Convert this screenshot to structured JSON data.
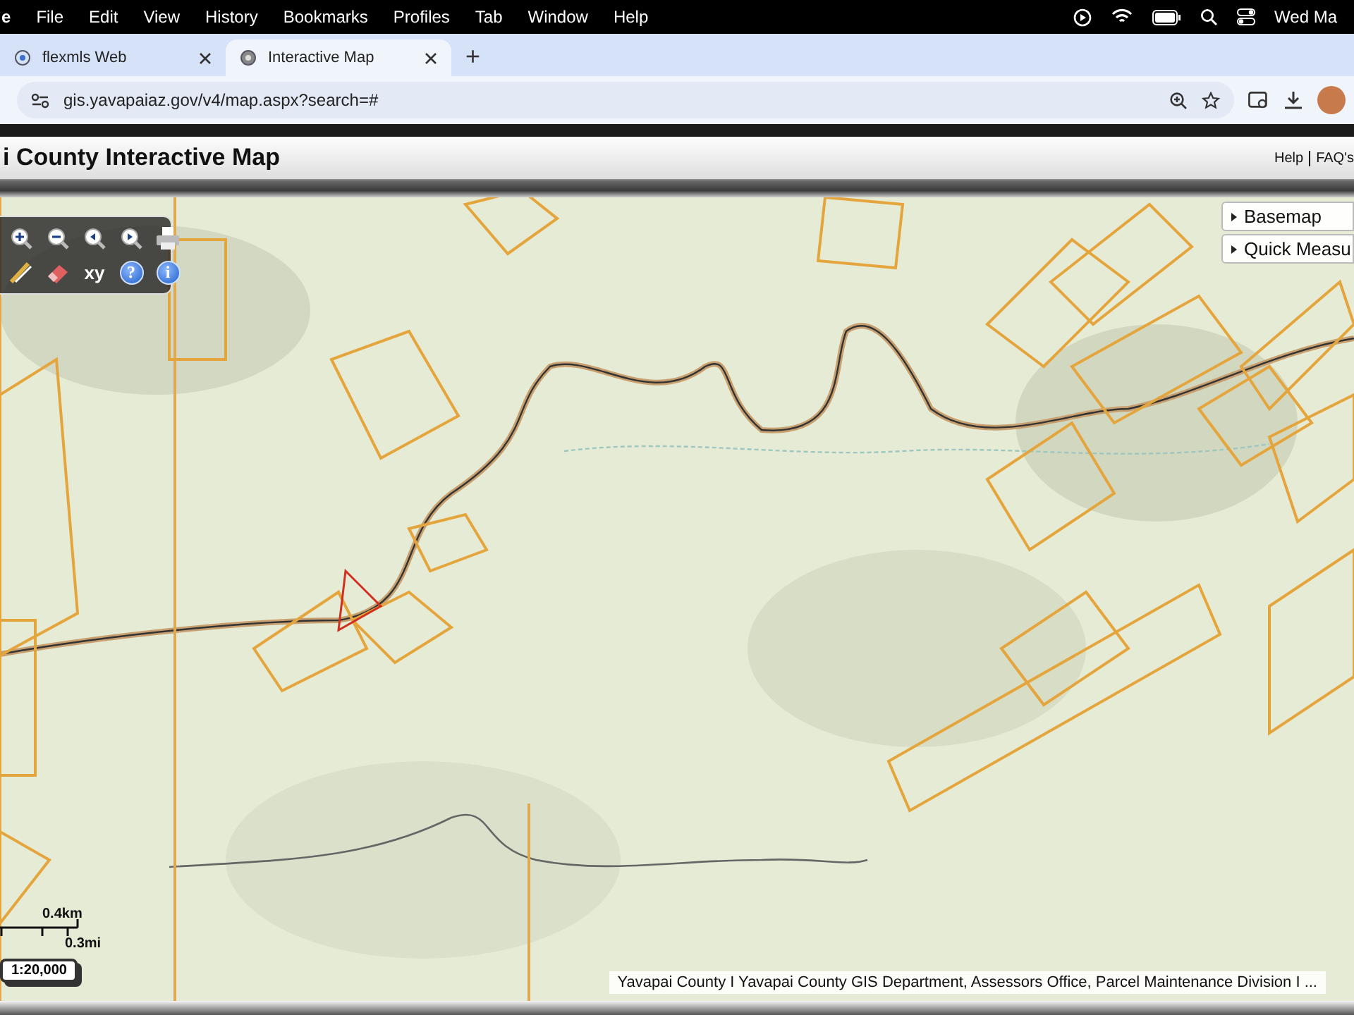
{
  "menu_bar": {
    "app": "e",
    "items": [
      "File",
      "Edit",
      "View",
      "History",
      "Bookmarks",
      "Profiles",
      "Tab",
      "Window",
      "Help"
    ],
    "clock": "Wed Ma"
  },
  "tabs": [
    {
      "title": "flexmls Web",
      "selected": false
    },
    {
      "title": "Interactive Map",
      "selected": true
    }
  ],
  "new_tab": "+",
  "address_bar": {
    "url": "gis.yavapaiaz.gov/v4/map.aspx?search=#"
  },
  "header": {
    "title": "i County Interactive Map",
    "links": [
      "Help",
      "FAQ's"
    ]
  },
  "map": {
    "toolbar": [
      {
        "kind": "zoom-in"
      },
      {
        "kind": "zoom-out"
      },
      {
        "kind": "back"
      },
      {
        "kind": "forward"
      },
      {
        "kind": "print"
      },
      {
        "kind": "pan"
      },
      {
        "kind": "eraser"
      },
      {
        "kind": "text",
        "label": "xy"
      },
      {
        "kind": "round",
        "label": "?"
      },
      {
        "kind": "round",
        "label": "i"
      }
    ],
    "layers": [
      {
        "label": "Basemap",
        "expanded": false
      },
      {
        "label": "Quick Measu",
        "expanded": false
      }
    ],
    "scale": {
      "km": "0.4km",
      "mi": "0.3mi",
      "ratio": "1:20,000"
    },
    "attribution": "Yavapai County I Yavapai County GIS Department, Assessors Office, Parcel Maintenance Division I ..."
  }
}
